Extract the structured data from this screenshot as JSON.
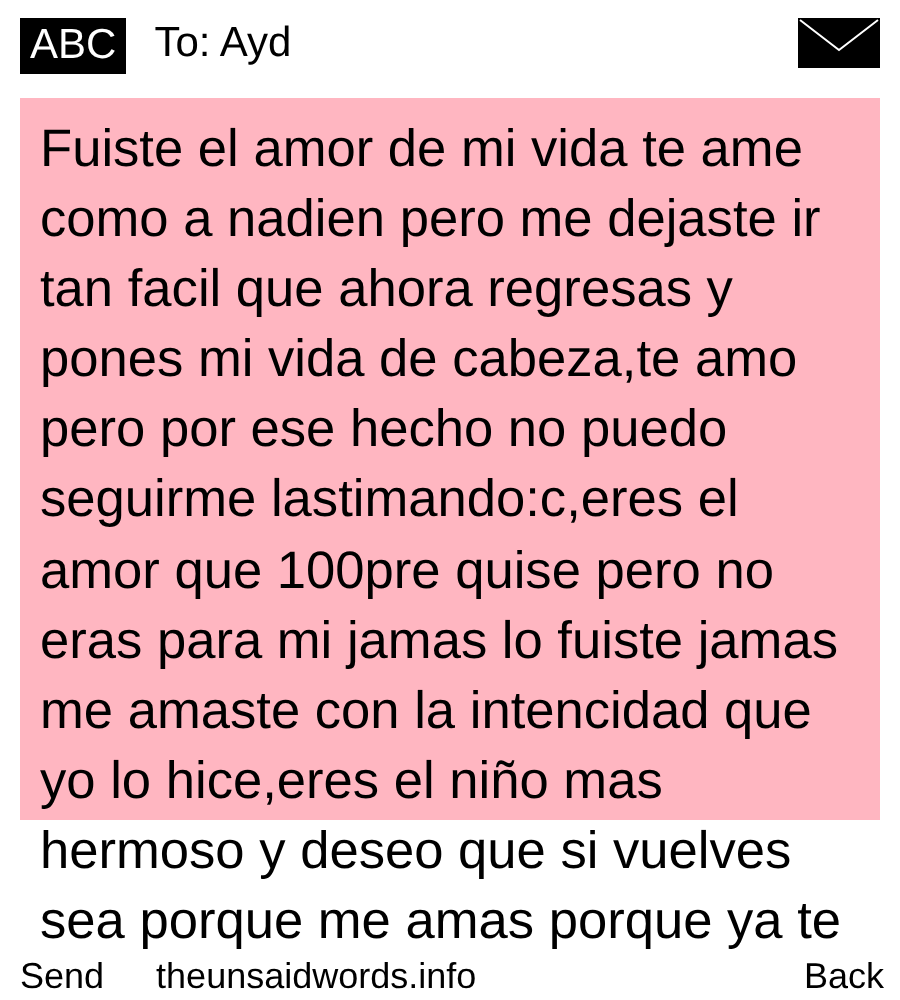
{
  "header": {
    "input_mode": "ABC",
    "recipient": "To: Ayd"
  },
  "message": {
    "text": "Fuiste el amor de mi vida te ame como a nadien pero me dejaste ir tan facil que ahora regresas y pones mi vida de cabeza,te amo pero por ese hecho no puedo seguirme lastimando:c,eres el amor que 100pre quise pero no eras para mi jamas lo fuiste jamas me amaste con la intencidad que yo lo hice,eres el niño mas hermoso y deseo que si vuelves sea porque me amas porque ya te"
  },
  "softkeys": [
    {
      "label": "Send"
    },
    {
      "label": "theunsaidwords.info"
    },
    {
      "label": "Back"
    }
  ]
}
